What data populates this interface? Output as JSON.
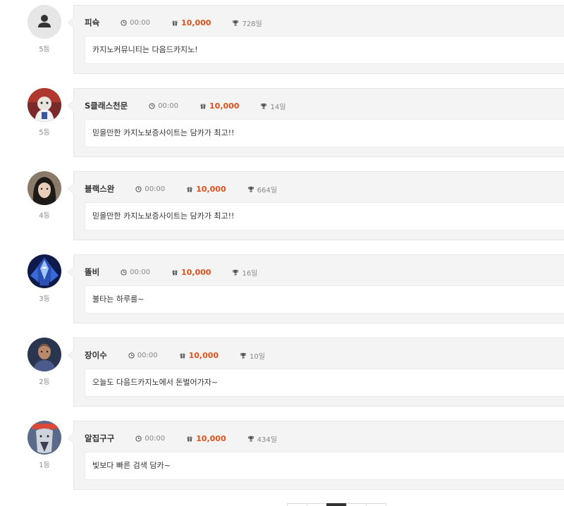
{
  "entries": [
    {
      "name": "피슉",
      "time": "00:00",
      "points": "10,000",
      "days": "728일",
      "rank": "5등",
      "message": "카지노커뮤니티는 다음드카지노!",
      "avatar": "default-user-icon"
    },
    {
      "name": "S클래스천문",
      "time": "00:00",
      "points": "10,000",
      "days": "14일",
      "rank": "5등",
      "message": "믿을만한 카지노보증사이트는 담카가 최고!!",
      "avatar": "character-photo"
    },
    {
      "name": "블랙스완",
      "time": "00:00",
      "points": "10,000",
      "days": "664일",
      "rank": "4등",
      "message": "믿을만한 카지노보증사이트는 담카가 최고!!",
      "avatar": "person-photo"
    },
    {
      "name": "똘비",
      "time": "00:00",
      "points": "10,000",
      "days": "16일",
      "rank": "3등",
      "message": "불타는 하루를~",
      "avatar": "robot-photo"
    },
    {
      "name": "장이수",
      "time": "00:00",
      "points": "10,000",
      "days": "10일",
      "rank": "2등",
      "message": "오늘도 다음드카지노에서 돈벌어가자~",
      "avatar": "person-photo"
    },
    {
      "name": "알집구구",
      "time": "00:00",
      "points": "10,000",
      "days": "434일",
      "rank": "1등",
      "message": "빛보다 빠른 검색 담카~",
      "avatar": "cartoon-photo"
    }
  ],
  "colors": {
    "points": "#e0521b",
    "card_bg": "#f4f4f4",
    "active_page": "#333333"
  },
  "icons": {
    "time": "clock-icon",
    "points": "gift-icon",
    "days": "trophy-icon"
  }
}
